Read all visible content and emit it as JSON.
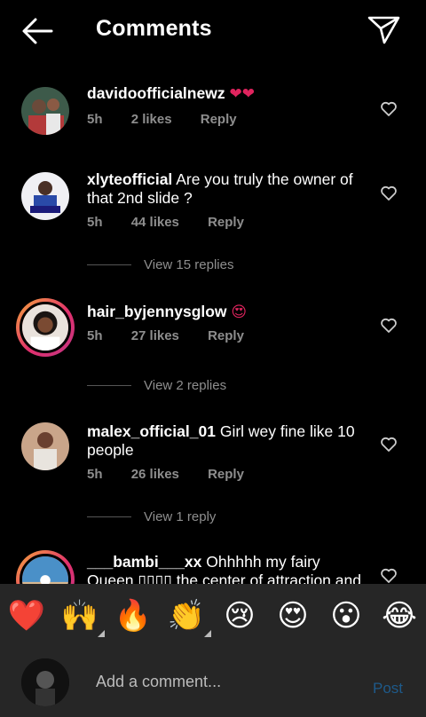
{
  "header": {
    "title": "Comments"
  },
  "comments": [
    {
      "username": "davidoofficialnewz",
      "text": "",
      "emoji": "❤❤",
      "time": "5h",
      "likes": "2 likes",
      "reply": "Reply"
    },
    {
      "username": "xlyteofficial",
      "text": "Are you truly the owner of that 2nd slide ?",
      "time": "5h",
      "likes": "44 likes",
      "reply": "Reply",
      "view_replies": "View 15 replies"
    },
    {
      "username": "hair_byjennysglow",
      "text": "",
      "emoji": "😍",
      "time": "5h",
      "likes": "27 likes",
      "reply": "Reply",
      "view_replies": "View 2 replies"
    },
    {
      "username": "malex_official_01",
      "text": "Girl wey fine like 10 people",
      "time": "5h",
      "likes": "26 likes",
      "reply": "Reply",
      "view_replies": "View 1 reply"
    },
    {
      "username": "___bambi___xx",
      "text": "Ohhhhh my fairy Queen ▯▯▯▯ the center of attraction and the"
    }
  ],
  "reactions": [
    "❤️",
    "🙌",
    "🔥",
    "👏",
    "😢",
    "😍",
    "😮",
    "😂"
  ],
  "composer": {
    "placeholder": "Add a comment...",
    "post_label": "Post"
  },
  "colors": {
    "background": "#000000",
    "panel": "#262626",
    "meta_text": "#8e8e8e",
    "post_disabled": "#1e5a8a",
    "story_ring": "#e1306c"
  }
}
